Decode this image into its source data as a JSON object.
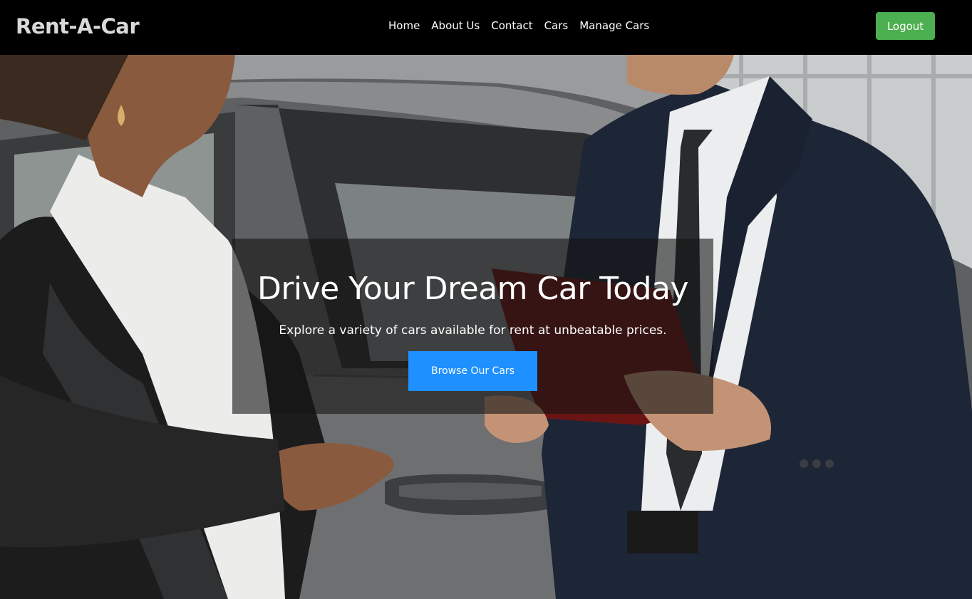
{
  "navbar": {
    "brand": "Rent-A-Car",
    "links": [
      {
        "label": "Home"
      },
      {
        "label": "About Us"
      },
      {
        "label": "Contact"
      },
      {
        "label": "Cars"
      },
      {
        "label": "Manage Cars"
      }
    ],
    "logout_label": "Logout"
  },
  "hero": {
    "title": "Drive Your Dream Car Today",
    "subtitle": "Explore a variety of cars available for rent at unbeatable prices.",
    "cta_label": "Browse Our Cars"
  },
  "colors": {
    "navbar_bg": "#000000",
    "logout_bg": "#4caf50",
    "cta_bg": "#1e90ff"
  }
}
